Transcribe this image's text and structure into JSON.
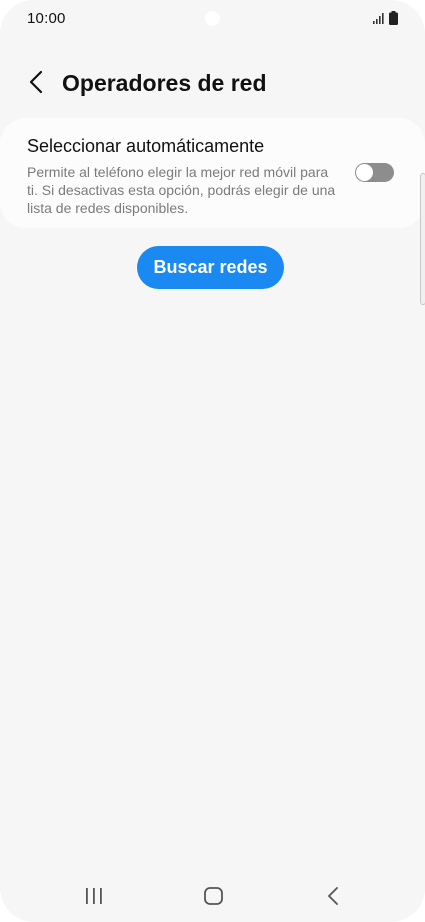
{
  "status_bar": {
    "time": "10:00",
    "signal_icon": "signal-icon",
    "battery_icon": "battery-icon"
  },
  "header": {
    "back_icon": "chevron-left-icon",
    "title": "Operadores de red"
  },
  "auto_select": {
    "title": "Seleccionar automáticamente",
    "description": "Permite al teléfono elegir la mejor red móvil para ti. Si desactivas esta opción, podrás elegir de una lista de redes disponibles.",
    "toggle_on": false
  },
  "search_button": {
    "label": "Buscar redes"
  },
  "nav_bar": {
    "recents_icon": "recents-icon",
    "home_icon": "home-icon",
    "back_icon": "back-icon"
  },
  "colors": {
    "accent": "#1a89f2",
    "background": "#f6f6f6",
    "toggle_off": "#8d8d8d"
  }
}
